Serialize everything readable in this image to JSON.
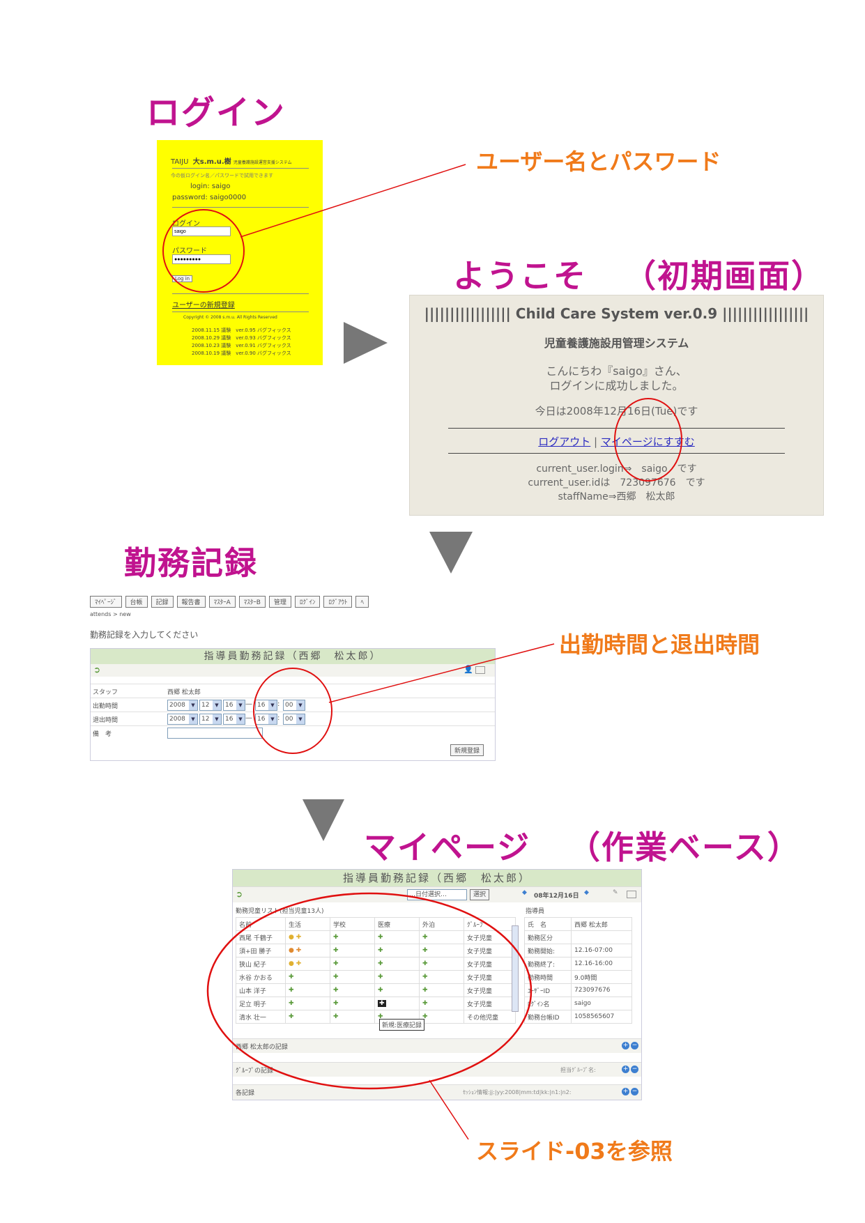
{
  "headings": {
    "login": "ログイン",
    "welcome": "ようこそ",
    "welcome_note": "（初期画面）",
    "attendance": "勤務記録",
    "mypage": "マイページ",
    "mypage_note": "（作業ベース）"
  },
  "callouts": {
    "user_pass": "ユーザー名とパスワード",
    "in_out_time": "出勤時間と退出時間",
    "slide_ref": "スライド-03を参照"
  },
  "login_panel": {
    "brand": "TAIJU",
    "brand_jp": "大s.m.u.樹",
    "brand_sub": "児童養護施設運営支援システム",
    "note": "今の仮ログイン名／パスワードで試用できます",
    "demo_login": "login: saigo",
    "demo_password": "password: saigo0000",
    "login_label": "ログイン",
    "login_value": "saigo",
    "password_label": "パスワード",
    "password_value": "●●●●●●●●●",
    "login_button": "Log in",
    "register_link": "ユーザーの新規登録",
    "copyright": "Copyright © 2008 s.m.u. All Rights Reserved",
    "history": [
      "2008.11.15 議験　ver.0.95 バグフィックス",
      "2008.10.29 議験　ver.0.93 バグフィックス",
      "2008.10.23 議験　ver.0.91 バグフィックス",
      "2008.10.19 議験　ver.0.90 バグフィックス"
    ]
  },
  "welcome_panel": {
    "title": "||||||||||||||||| Child Care System ver.0.9 |||||||||||||||||",
    "subtitle": "児童養護施設用管理システム",
    "greeting1": "こんにちわ『saigo』さん、",
    "greeting2": "ログインに成功しました。",
    "today": "今日は2008年12月16日(Tue)です",
    "logout_link": "ログアウト",
    "separator": "|",
    "mypage_link": "マイページにすすむ",
    "current_login": "current_user.login⇒　saigo　です",
    "current_id": "current_user.idは　723097676　です",
    "staff_name": "staffName⇒西郷　松太郎"
  },
  "attendance_panel": {
    "tabs": [
      "ﾏｲﾍﾟｰｼﾞ",
      "台帳",
      "記録",
      "報告書",
      "ﾏｽﾀｰA",
      "ﾏｽﾀｰB",
      "管理",
      "ﾛｸﾞｲﾝ",
      "ﾛｸﾞｱｳﾄ",
      "ﾍ"
    ],
    "breadcrumb": "attends > new",
    "instruction": "勤務記録を入力してください",
    "form_title": "指導員勤務記録（西郷　松太郎）",
    "staff_label": "スタッフ",
    "staff_value": "西郷 松太郎",
    "in_label": "出勤時間",
    "out_label": "退出時間",
    "note_label": "備　考",
    "year": "2008",
    "month": "12",
    "day": "16",
    "hour": "16",
    "minute": "00",
    "dash": "—",
    "colon": ":",
    "submit": "新規登録"
  },
  "mypage_panel": {
    "title": "指導員勤務記録（西郷　松太郎）",
    "date_select": "…日付選択…",
    "select_button": "選択",
    "date": "08年12月16日",
    "list_title": "勤務児童リスト(担当児童13人)",
    "columns": [
      "名前",
      "生活",
      "学校",
      "医療",
      "外泊",
      "ｸﾞﾙｰﾌﾟ"
    ],
    "rows": [
      {
        "name": "西尾 千鶴子",
        "group": "女子児童"
      },
      {
        "name": "須+田 勝子",
        "group": "女子児童"
      },
      {
        "name": "狭山 紀子",
        "group": "女子児童"
      },
      {
        "name": "水谷 かおる",
        "group": "女子児童"
      },
      {
        "name": "山本 洋子",
        "group": "女子児童"
      },
      {
        "name": "足立 明子",
        "group": "女子児童"
      },
      {
        "name": "清水 壮一",
        "group": "その他児童"
      }
    ],
    "tooltip": "新規:医療記録",
    "staff_section": "指導員",
    "staff_info": [
      {
        "k": "氏　名",
        "v": "西郷 松太郎"
      },
      {
        "k": "勤務区分",
        "v": ""
      },
      {
        "k": "勤務開始:",
        "v": "12.16-07:00"
      },
      {
        "k": "勤務終了:",
        "v": "12.16-16:00"
      },
      {
        "k": "勤務時間",
        "v": "9.0時間"
      },
      {
        "k": "ﾕｰｻﾞｰID",
        "v": "723097676"
      },
      {
        "k": "ﾛｸﾞｲﾝ名",
        "v": "saigo"
      },
      {
        "k": "勤務台帳ID",
        "v": "1058565607"
      }
    ],
    "record1": "西郷 松太郎の記録",
    "record2": "ｸﾞﾙｰﾌﾟの記録",
    "record2_right": "担当ｸﾞﾙｰﾌﾟ名:",
    "record3": "各記録",
    "record3_right": "ｾｯｼｮﾝ情報:jj:|yy:2008|mm:td|kk:|n1:|n2:"
  }
}
